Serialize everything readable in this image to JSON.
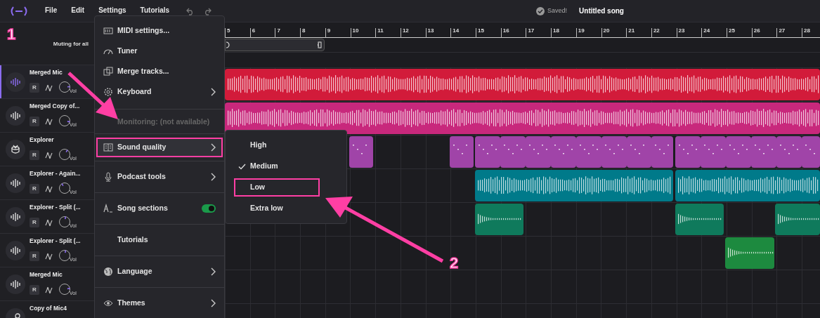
{
  "top_bar": {
    "menus": [
      {
        "label": "File",
        "selected": false
      },
      {
        "label": "Edit",
        "selected": false
      },
      {
        "label": "Settings",
        "selected": false
      },
      {
        "label": "Tutorials",
        "selected": false
      }
    ],
    "save_status": "Saved!",
    "song_title": "Untitled song"
  },
  "header": {
    "muting_label": "Muting for all"
  },
  "ruler": [
    "5",
    "6",
    "7",
    "8",
    "9",
    "10",
    "11",
    "12",
    "13",
    "14",
    "15",
    "16",
    "17",
    "18",
    "19",
    "20",
    "21",
    "22",
    "23",
    "24",
    "25",
    "26",
    "27",
    "28"
  ],
  "tracks": [
    {
      "name": "Merged Mic",
      "kind": "audio",
      "selected": true,
      "record_label": "R",
      "volume_label": "Vol",
      "color": "#d21b3a"
    },
    {
      "name": "Merged Copy of...",
      "kind": "audio",
      "selected": false,
      "record_label": "R",
      "volume_label": "Vol",
      "color": "#c8287c"
    },
    {
      "name": "Explorer",
      "kind": "drums",
      "selected": false,
      "record_label": "R",
      "volume_label": "Vol",
      "color": "#a044a8"
    },
    {
      "name": "Explorer - Again...",
      "kind": "audio",
      "selected": false,
      "record_label": "R",
      "volume_label": "Vol",
      "color": "#007a8a"
    },
    {
      "name": "Explorer - Split (...",
      "kind": "audio",
      "selected": false,
      "record_label": "R",
      "volume_label": "Vol",
      "color": "#0f7a5c"
    },
    {
      "name": "Explorer - Split (...",
      "kind": "audio",
      "selected": false,
      "record_label": "R",
      "volume_label": "Vol",
      "color": "#1d8a3f"
    },
    {
      "name": "Merged Mic",
      "kind": "audio",
      "selected": false,
      "record_label": "R",
      "volume_label": "Vol"
    },
    {
      "name": "Copy of Mic4",
      "kind": "mic",
      "selected": false
    }
  ],
  "settings_menu": {
    "groups": [
      {
        "items": [
          {
            "label": "MIDI settings...",
            "kind": "midi",
            "submenu": false
          },
          {
            "label": "Tuner",
            "kind": "tuner",
            "submenu": false
          },
          {
            "label": "Merge tracks...",
            "kind": "merge",
            "submenu": false
          },
          {
            "label": "Keyboard",
            "kind": "gear",
            "submenu": true
          }
        ]
      },
      {
        "items": [
          {
            "label": "Monitoring: (not available)",
            "kind": "none",
            "submenu": false,
            "disabled": true
          }
        ]
      },
      {
        "items": [
          {
            "label": "Sound quality",
            "kind": "quality",
            "submenu": true,
            "highlighted": true
          }
        ]
      },
      {
        "items": [
          {
            "label": "Podcast tools",
            "kind": "mic",
            "submenu": true
          }
        ]
      },
      {
        "items": [
          {
            "label": "Song sections",
            "kind": "sections",
            "submenu": false,
            "toggle": true,
            "on": true
          }
        ]
      },
      {
        "items": [
          {
            "label": "Tutorials",
            "kind": "none",
            "submenu": false
          }
        ]
      },
      {
        "items": [
          {
            "label": "Language",
            "kind": "globe",
            "submenu": true
          }
        ]
      },
      {
        "items": [
          {
            "label": "Themes",
            "kind": "eye",
            "submenu": true
          }
        ]
      }
    ]
  },
  "sound_quality_menu": [
    {
      "label": "High",
      "checked": false,
      "highlighted": false
    },
    {
      "label": "Medium",
      "checked": true,
      "highlighted": false
    },
    {
      "label": "Low",
      "checked": false,
      "highlighted": true
    },
    {
      "label": "Extra low",
      "checked": false,
      "highlighted": false
    }
  ],
  "annotations": [
    "1",
    "2"
  ]
}
